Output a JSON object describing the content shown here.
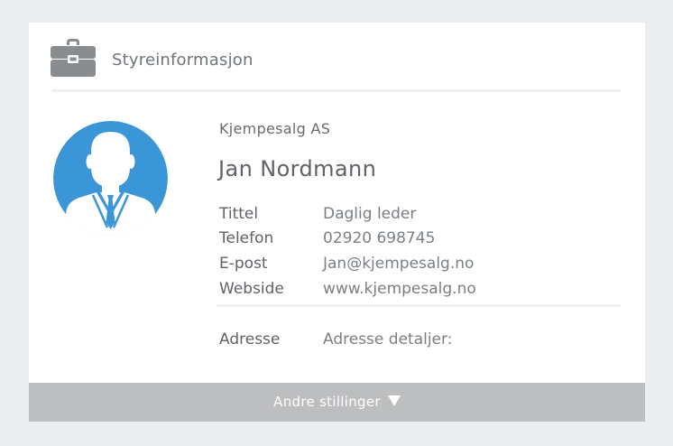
{
  "panel": {
    "title": "Styreinformasjon",
    "icon": "briefcase-icon",
    "icon_color": "#8a8d90"
  },
  "contact": {
    "company": "Kjempesalg AS",
    "name": "Jan Nordmann",
    "avatar_icon": "person-avatar-icon",
    "avatar_color": "#3a96d6",
    "fields": [
      {
        "label": "Tittel",
        "value": "Daglig leder"
      },
      {
        "label": "Telefon",
        "value": "02920 698745"
      },
      {
        "label": "E-post",
        "value": "Jan@kjempesalg.no"
      },
      {
        "label": "Webside",
        "value": "www.kjempesalg.no"
      }
    ],
    "address": {
      "label": "Adresse",
      "value": "Adresse detaljer:"
    }
  },
  "footer": {
    "label": "Andre stillinger",
    "icon": "caret-down-icon",
    "background": "#bcbec0"
  }
}
